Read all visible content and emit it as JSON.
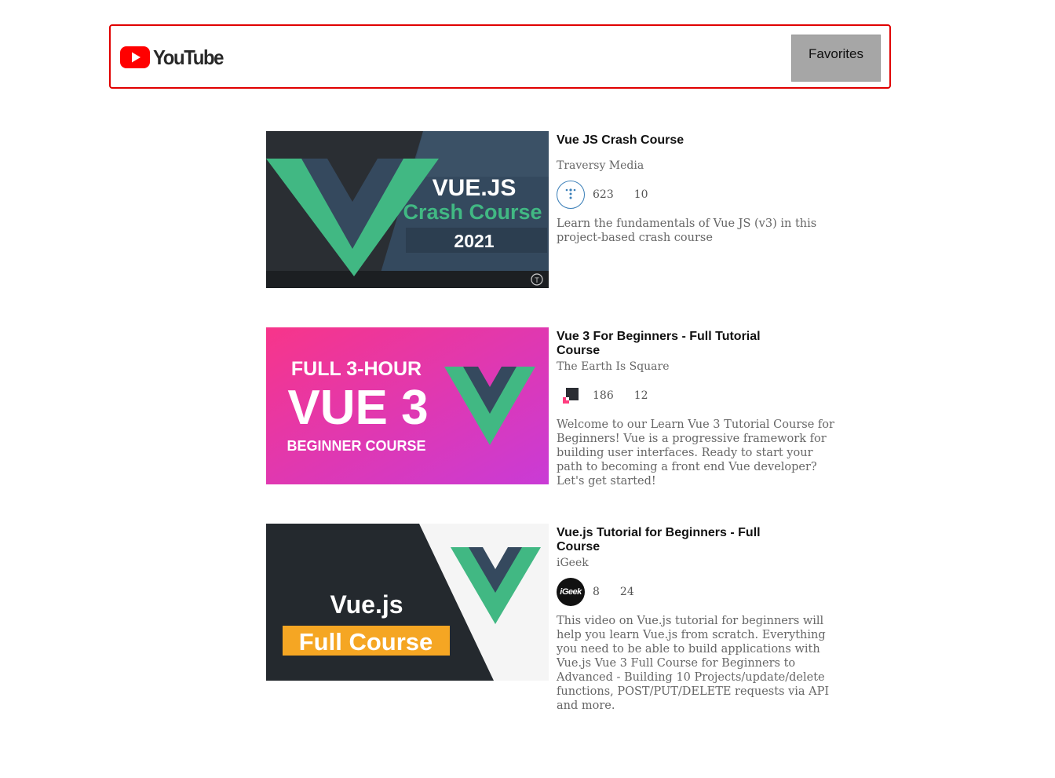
{
  "header": {
    "logo_text": "YouTube",
    "favorites_label": "Favorites",
    "border_color": "#e00000",
    "logo_red": "#ff0000"
  },
  "videos": [
    {
      "title": "Vue JS Crash Course",
      "channel": "Traversy Media",
      "views": "623",
      "likes": "10",
      "description": "Learn the fundamentals of Vue JS (v3) in this project-based crash course",
      "thumb_text": [
        "VUE.JS",
        "Crash Course",
        "2021"
      ],
      "avatar_icon": "traversy-logo-icon"
    },
    {
      "title": "Vue 3 For Beginners - Full Tutorial Course",
      "channel": "The Earth Is Square",
      "views": "186",
      "likes": "12",
      "description": "Welcome to our Learn Vue 3 Tutorial Course for Beginners! Vue is a progressive framework for building user interfaces. Ready to start your path to becoming a front end Vue developer? Let's get started!",
      "thumb_text": [
        "FULL 3-HOUR",
        "VUE 3",
        "BEGINNER COURSE"
      ],
      "avatar_icon": "earth-is-square-logo-icon"
    },
    {
      "title": "Vue.js Tutorial for Beginners - Full Course",
      "channel": "iGeek",
      "views": "8",
      "likes": "24",
      "description": "This video on Vue.js tutorial for beginners will help you learn Vue.js from scratch. Everything you need to be able to build applications with Vue.js Vue 3 Full Course for Beginners to Advanced - Building 10 Projects/update/delete functions, POST/PUT/DELETE requests via API and more.",
      "thumb_text": [
        "Vue.js",
        "Full Course"
      ],
      "avatar_text": "iGeek",
      "avatar_icon": "igeek-logo-icon"
    }
  ]
}
